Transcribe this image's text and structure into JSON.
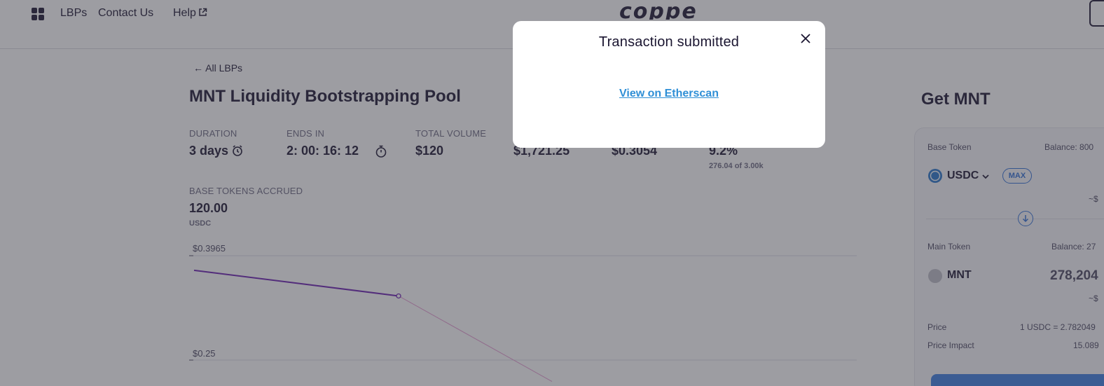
{
  "header": {
    "nav": [
      "LBPs",
      "Contact Us",
      "Help"
    ],
    "logo_text": "coppe"
  },
  "main": {
    "back_link": "← All LBPs",
    "pool_title": "MNT Liquidity Bootstrapping Pool",
    "stats": [
      {
        "label": "DURATION",
        "value": "3 days"
      },
      {
        "label": "ENDS IN",
        "value": "2: 00: 16: 12"
      },
      {
        "label": "TOTAL VOLUME",
        "value": "$120"
      },
      {
        "label": "",
        "value": "$1,721.25"
      },
      {
        "label": "",
        "value": "$0.3054"
      },
      {
        "label": "",
        "value": "9.2%",
        "sub": "276.04 of 3.00k"
      }
    ],
    "base_tokens": {
      "label": "BASE TOKENS ACCRUED",
      "value": "120.00",
      "unit": "USDC"
    }
  },
  "chart_data": {
    "type": "line",
    "ytick_labels": [
      "$0.3965",
      "$0.25"
    ],
    "series": [
      {
        "values": [
          0.376,
          0.34
        ],
        "color": "#6a1fb0",
        "style": "solid"
      },
      {
        "values": [
          0.34,
          0.22
        ],
        "color": "#e49ad0",
        "style": "thin"
      }
    ]
  },
  "panel": {
    "title": "Get MNT",
    "base_token_label": "Base Token",
    "base_balance": "Balance: 800",
    "base_token": "USDC",
    "max_label": "MAX",
    "base_usd": "~$",
    "main_token_label": "Main Token",
    "main_balance": "Balance: 27",
    "main_token": "MNT",
    "main_amount": "278,204",
    "main_usd": "~$",
    "price_label": "Price",
    "price_value": "1 USDC = 2.782049",
    "impact_label": "Price Impact",
    "impact_value": "15.089"
  },
  "modal": {
    "title": "Transaction submitted",
    "link": "View on Etherscan"
  },
  "colors": {
    "accent_blue": "#2f6fd6",
    "link_blue": "#2f8fd6",
    "purple_line": "#6a1fb0",
    "pink_line": "#e49ad0",
    "usdc_blue": "#2775ca",
    "overlay": "rgba(60,60,70,0.5)"
  }
}
